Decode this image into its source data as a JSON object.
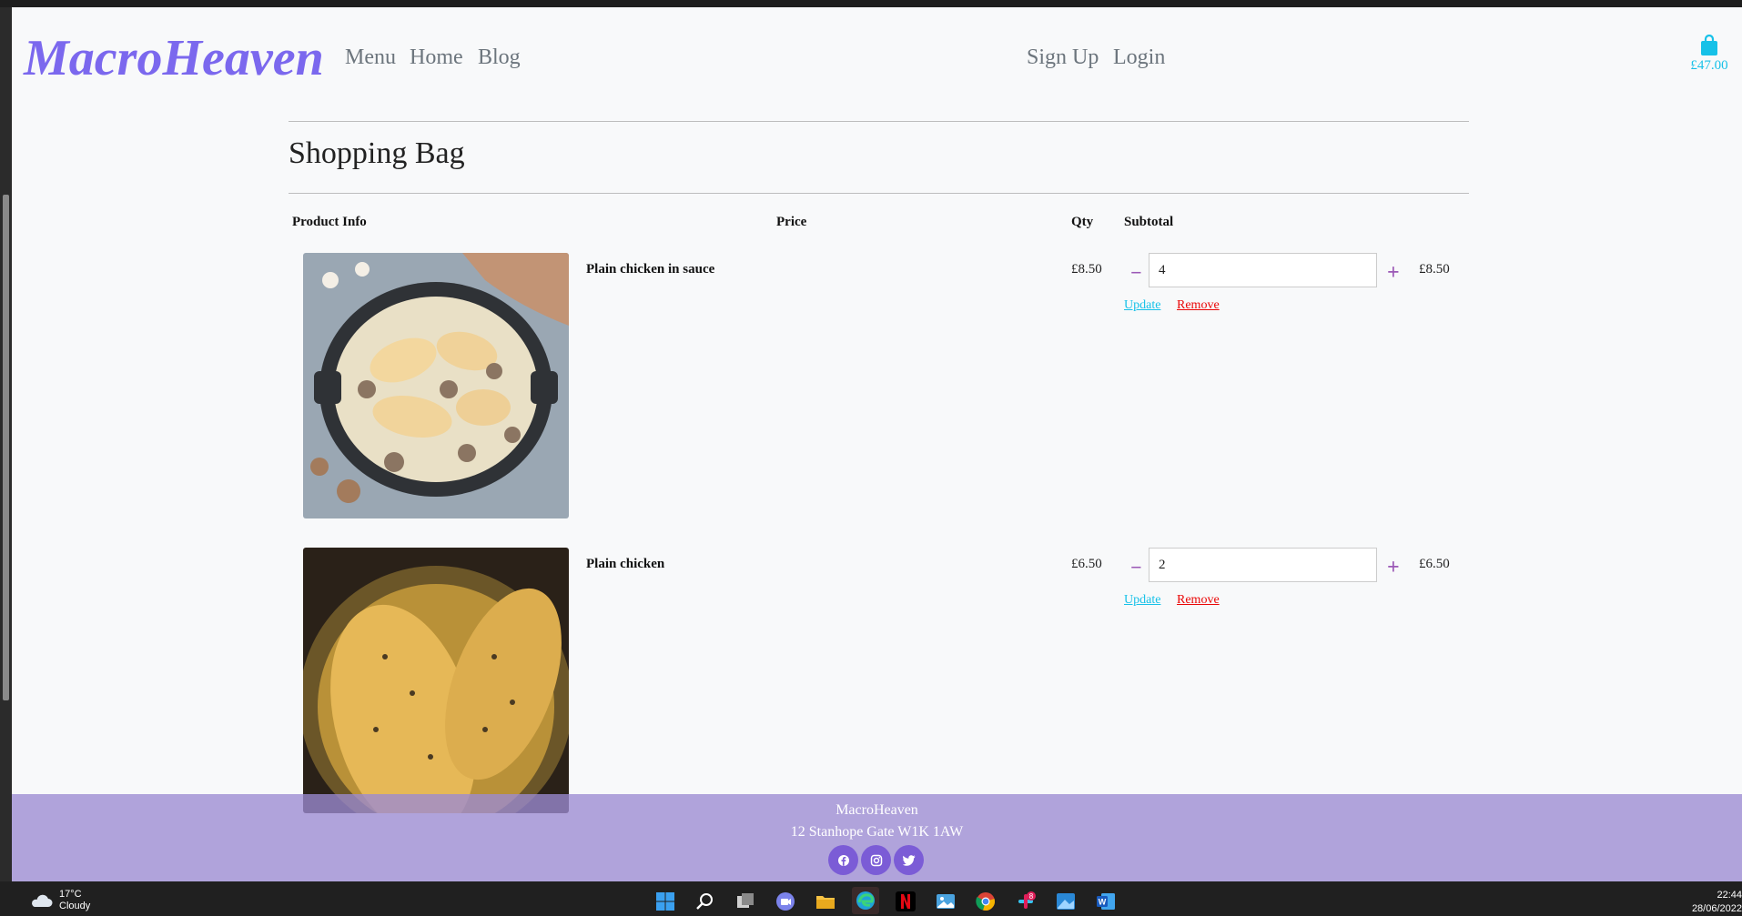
{
  "header": {
    "logo": "MacroHeaven",
    "nav": {
      "menu": "Menu",
      "home": "Home",
      "blog": "Blog",
      "signup": "Sign Up",
      "login": "Login"
    },
    "bag_total": "£47.00"
  },
  "page": {
    "title": "Shopping Bag",
    "columns": {
      "product": "Product Info",
      "price": "Price",
      "qty": "Qty",
      "subtotal": "Subtotal"
    }
  },
  "items": [
    {
      "name": "Plain chicken in sauce",
      "price": "£8.50",
      "qty": "4",
      "subtotal": "£8.50",
      "update": "Update",
      "remove": "Remove",
      "minus": "−",
      "plus": "+"
    },
    {
      "name": "Plain chicken",
      "price": "£6.50",
      "qty": "2",
      "subtotal": "£6.50",
      "update": "Update",
      "remove": "Remove",
      "minus": "−",
      "plus": "+"
    }
  ],
  "footer": {
    "name": "MacroHeaven",
    "address": "12 Stanhope Gate W1K 1AW",
    "socials": [
      "facebook-icon",
      "instagram-icon",
      "twitter-icon"
    ]
  },
  "taskbar": {
    "temperature": "17°C",
    "weather": "Cloudy",
    "time": "22:44",
    "date": "28/06/2022"
  },
  "colors": {
    "brand": "#7b68ee",
    "accent": "#17c1e8",
    "danger": "#ea0606",
    "footer": "#9b8ad2"
  }
}
